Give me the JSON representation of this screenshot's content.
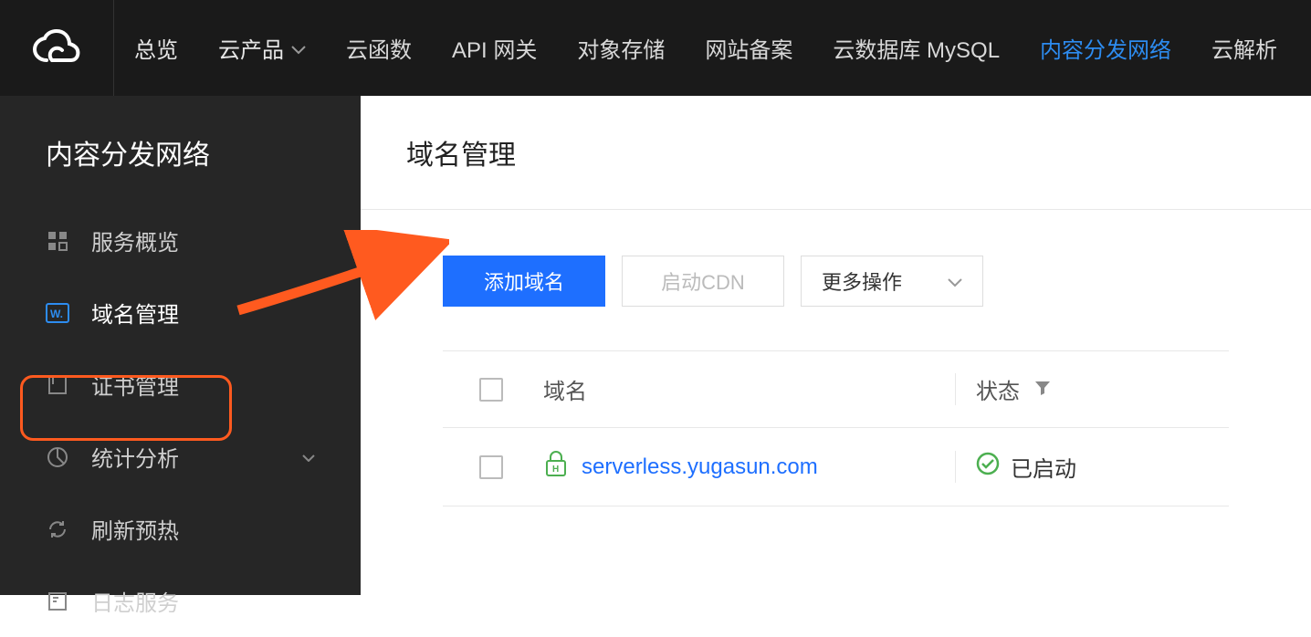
{
  "topnav": {
    "items": [
      {
        "label": "总览"
      },
      {
        "label": "云产品"
      },
      {
        "label": "云函数"
      },
      {
        "label": "API 网关"
      },
      {
        "label": "对象存储"
      },
      {
        "label": "网站备案"
      },
      {
        "label": "云数据库 MySQL"
      },
      {
        "label": "内容分发网络"
      },
      {
        "label": "云解析"
      }
    ]
  },
  "sidebar": {
    "title": "内容分发网络",
    "items": [
      {
        "label": "服务概览"
      },
      {
        "label": "域名管理"
      },
      {
        "label": "证书管理"
      },
      {
        "label": "统计分析"
      },
      {
        "label": "刷新预热"
      },
      {
        "label": "日志服务"
      }
    ]
  },
  "page": {
    "title": "域名管理",
    "actions": {
      "add": "添加域名",
      "start": "启动CDN",
      "more": "更多操作"
    },
    "table": {
      "headers": {
        "domain": "域名",
        "status": "状态"
      },
      "rows": [
        {
          "domain": "serverless.yugasun.com",
          "status": "已启动"
        }
      ]
    }
  }
}
